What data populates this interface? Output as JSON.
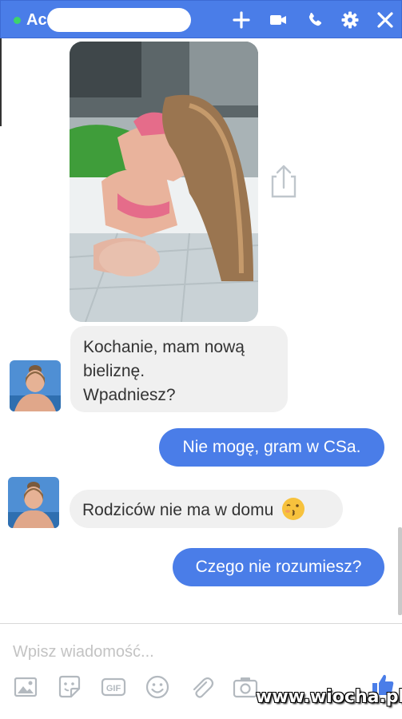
{
  "header": {
    "contact_name": "Ac",
    "status": "online",
    "icons": [
      "plus-icon",
      "video-camera-icon",
      "phone-icon",
      "gear-icon",
      "close-icon"
    ],
    "accent_color": "#4a7de8",
    "online_color": "#3dd36b"
  },
  "conversation": {
    "messages": [
      {
        "direction": "incoming",
        "type": "image",
        "description_icon": "share-icon"
      },
      {
        "direction": "incoming",
        "text": "Kochanie, mam nową\nbieliznę.\nWpadniesz?"
      },
      {
        "direction": "outgoing",
        "text": "Nie mogę, gram w CSa."
      },
      {
        "direction": "incoming",
        "text": "Rodziców nie ma w domu",
        "emoji": "kissing-face-emoji"
      },
      {
        "direction": "outgoing",
        "text": "Czego nie rozumiesz?"
      }
    ]
  },
  "composer": {
    "placeholder": "Wpisz wiadomość...",
    "tools": [
      "image-icon",
      "sticker-icon",
      "gif-icon",
      "emoji-icon",
      "attachment-icon",
      "camera-icon",
      "thumbs-up-icon"
    ],
    "gif_label": "GIF"
  },
  "watermark": "www.wiocha.pl"
}
